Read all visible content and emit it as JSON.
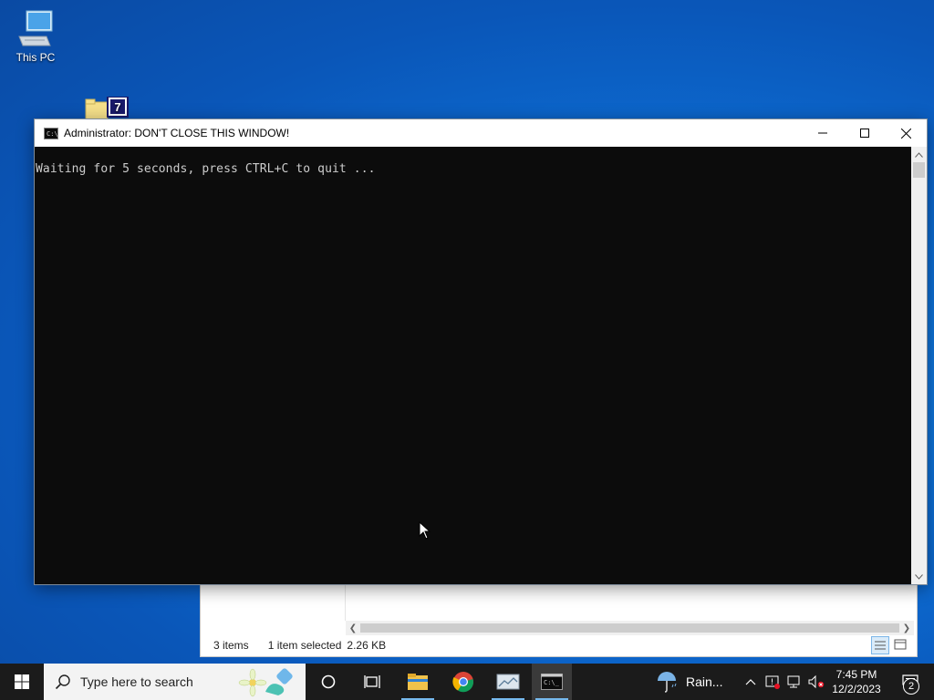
{
  "desktop": {
    "icons": [
      {
        "label": "This PC",
        "icon": "this-pc-icon"
      },
      {
        "label": "",
        "icon": "7zip-folder-icon"
      }
    ]
  },
  "console": {
    "title": "Administrator:  DON'T CLOSE THIS WINDOW!",
    "output": "Waiting for 5 seconds, press CTRL+C to quit ...",
    "background": "#0c0c0c",
    "text_color": "#cccccc"
  },
  "explorer": {
    "status_items": "3 items",
    "status_selected": "1 item selected",
    "status_size": "2.26 KB"
  },
  "taskbar": {
    "search_placeholder": "Type here to search",
    "weather": "Rain...",
    "time": "7:45 PM",
    "date": "12/2/2023",
    "notification_count": "2"
  },
  "colors": {
    "taskbar": "#1b1b1b",
    "desktop_accent": "#0d6fd6",
    "active_indicator": "#76b9ed"
  }
}
